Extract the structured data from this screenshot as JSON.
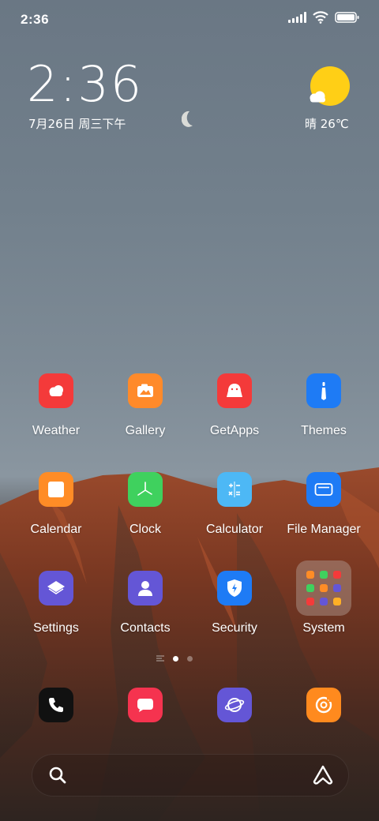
{
  "status_bar": {
    "time": "2:36",
    "icons": [
      "signal-icon",
      "wifi-icon",
      "battery-icon"
    ]
  },
  "widget": {
    "time": "2:36",
    "date": "7月26日 周三下午",
    "weather": "晴 26℃",
    "weather_icon": "sunny-cloud-icon"
  },
  "apps": [
    {
      "label": "Weather",
      "icon": "weather-icon",
      "color": "#f43a3a"
    },
    {
      "label": "Gallery",
      "icon": "gallery-icon",
      "color": "#ff8a2a"
    },
    {
      "label": "GetApps",
      "icon": "getapps-icon",
      "color": "#f43a3a"
    },
    {
      "label": "Themes",
      "icon": "themes-icon",
      "color": "#1e7bf5"
    },
    {
      "label": "Calendar",
      "icon": "calendar-icon",
      "color": "#ff8c26"
    },
    {
      "label": "Clock",
      "icon": "clock-icon",
      "color": "#3fd15e"
    },
    {
      "label": "Calculator",
      "icon": "calculator-icon",
      "color": "#4db8f5"
    },
    {
      "label": "File Manager",
      "icon": "folder-icon",
      "color": "#1e7bf5"
    },
    {
      "label": "Settings",
      "icon": "settings-icon",
      "color": "#6456d6"
    },
    {
      "label": "Contacts",
      "icon": "contacts-icon",
      "color": "#6456d6"
    },
    {
      "label": "Security",
      "icon": "shield-icon",
      "color": "#1e7bf5"
    },
    {
      "label": "System",
      "icon": "folder-group-icon",
      "color": "#b4a096"
    }
  ],
  "page_indicator": {
    "pages": 2,
    "current": 1
  },
  "dock": [
    {
      "icon": "phone-icon",
      "color": "#111111"
    },
    {
      "icon": "messages-icon",
      "color": "#f5334f"
    },
    {
      "icon": "browser-icon",
      "color": "#6456d6"
    },
    {
      "icon": "music-icon",
      "color": "#ff8a1e"
    }
  ],
  "search_bar": {
    "icons": [
      "search-icon",
      "assistant-icon"
    ]
  }
}
